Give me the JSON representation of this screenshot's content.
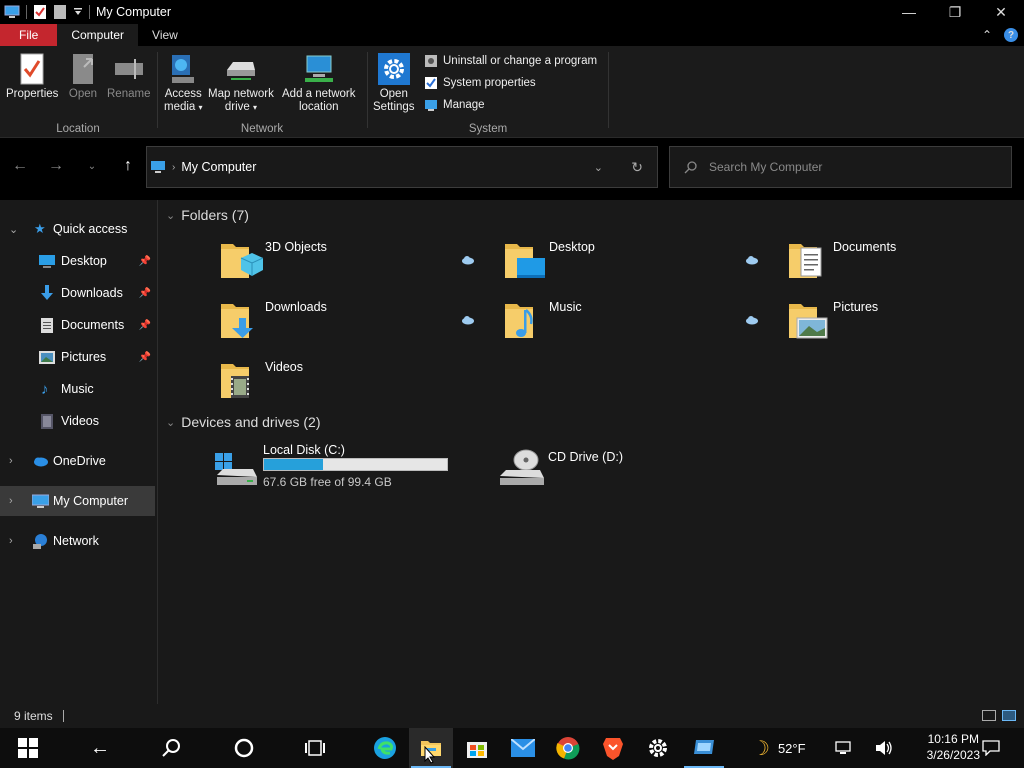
{
  "window": {
    "title": "My Computer"
  },
  "tabs": {
    "file": "File",
    "computer": "Computer",
    "view": "View"
  },
  "ribbon": {
    "location": {
      "label": "Location",
      "properties": "Properties",
      "open": "Open",
      "rename": "Rename"
    },
    "network": {
      "label": "Network",
      "access_media_1": "Access",
      "access_media_2": "media",
      "map_drive_1": "Map network",
      "map_drive_2": "drive",
      "add_location_1": "Add a network",
      "add_location_2": "location"
    },
    "system": {
      "label": "System",
      "open_settings_1": "Open",
      "open_settings_2": "Settings",
      "uninstall": "Uninstall or change a program",
      "system_properties": "System properties",
      "manage": "Manage"
    }
  },
  "address": {
    "path": "My Computer",
    "search_placeholder": "Search My Computer"
  },
  "navpane": {
    "quick_access": "Quick access",
    "items": [
      "Desktop",
      "Downloads",
      "Documents",
      "Pictures",
      "Music",
      "Videos"
    ],
    "onedrive": "OneDrive",
    "my_computer": "My Computer",
    "network": "Network"
  },
  "content": {
    "folders_header": "Folders (7)",
    "folders": [
      "3D Objects",
      "Desktop",
      "Documents",
      "Downloads",
      "Music",
      "Pictures",
      "Videos"
    ],
    "devices_header": "Devices and drives (2)",
    "drives": [
      {
        "name": "Local Disk (C:)",
        "free": "67.6 GB free of 99.4 GB",
        "used_fraction": 0.32
      },
      {
        "name": "CD Drive (D:)"
      }
    ]
  },
  "status": {
    "items": "9 items"
  },
  "taskbar": {
    "weather": "52°F",
    "time": "10:16 PM",
    "date": "3/26/2023",
    "icons": [
      "windows-start-icon",
      "back-icon",
      "search-icon",
      "cortana-icon",
      "task-view-icon",
      "edge-icon",
      "file-explorer-icon",
      "store-icon",
      "mail-icon",
      "chrome-icon",
      "brave-icon",
      "settings-icon",
      "remote-desktop-icon"
    ]
  },
  "colors": {
    "accent": "#26a0da",
    "file_tab": "#c4262e",
    "folder": "#f2c55c"
  }
}
